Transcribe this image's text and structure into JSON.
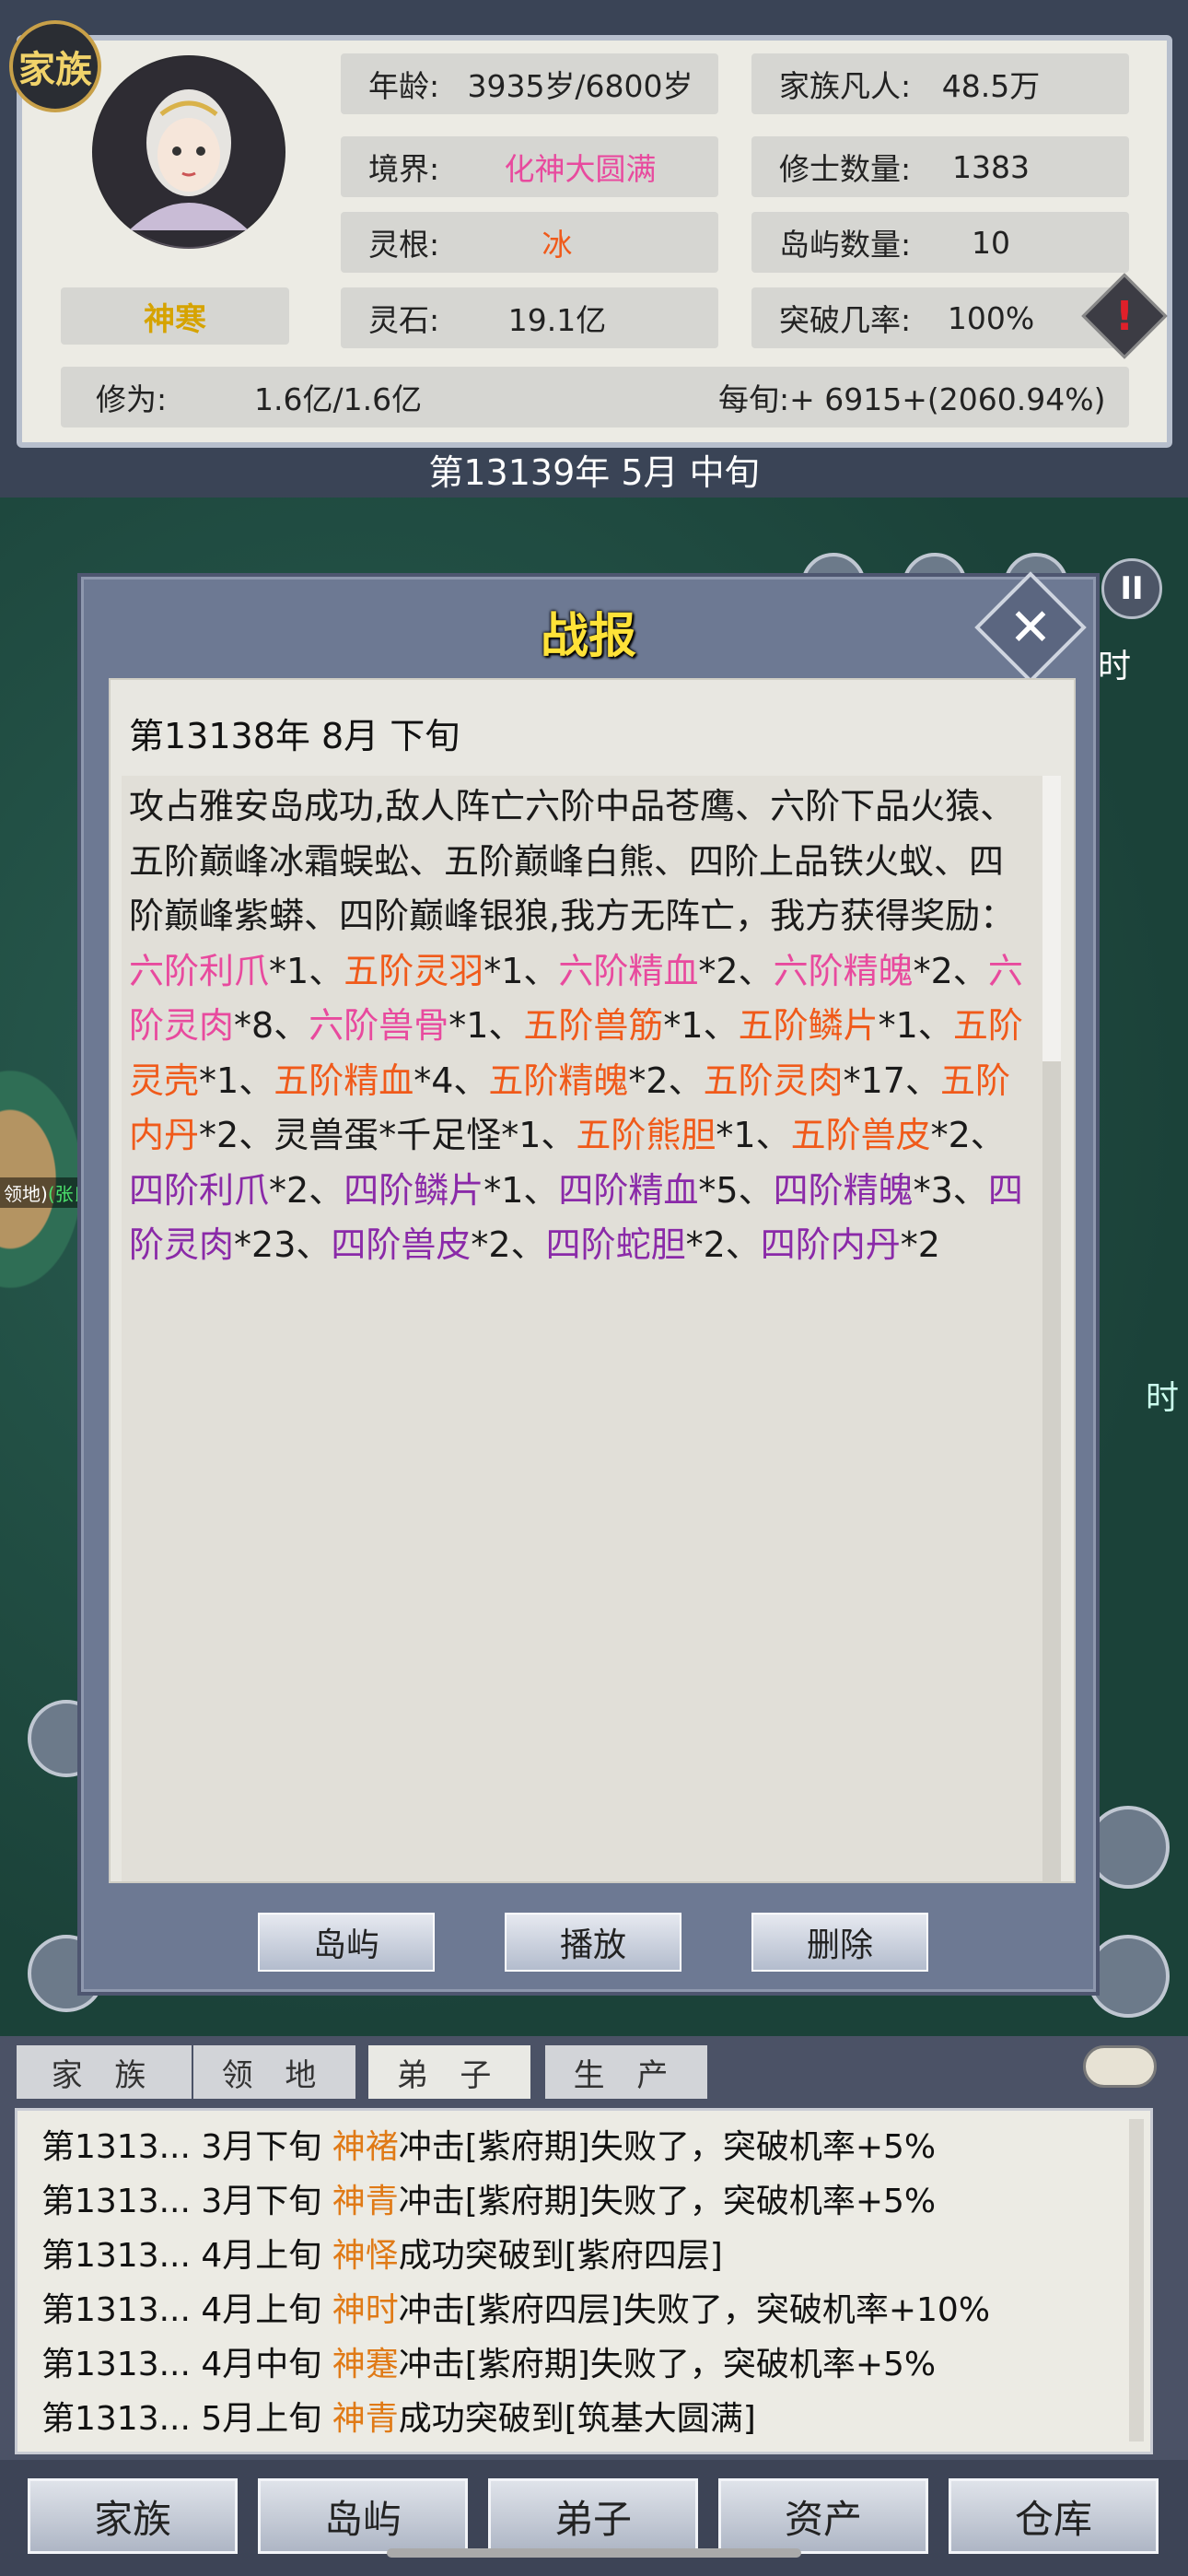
{
  "header": {
    "clan_badge": "家族",
    "character_name": "神寒",
    "age_label": "年龄:",
    "age_value": "3935岁/6800岁",
    "realm_label": "境界:",
    "realm_value": "化神大圆满",
    "spirit_root_label": "灵根:",
    "spirit_root_value": "冰",
    "spirit_stone_label": "灵石:",
    "spirit_stone_value": "19.1亿",
    "mortals_label": "家族凡人:",
    "mortals_value": "48.5万",
    "cultivators_label": "修士数量:",
    "cultivators_value": "1383",
    "islands_label": "岛屿数量:",
    "islands_value": "10",
    "breakthrough_label": "突破几率:",
    "breakthrough_value": "100%",
    "alert_icon": "exclamation-icon",
    "cultivation_label": "修为:",
    "cultivation_value": "1.6亿/1.6亿",
    "per_period": "每旬:+ 6915+(2060.94%)",
    "date": "第13139年 5月 中旬"
  },
  "map": {
    "island_label_prefix": "领地)",
    "island_label_owner": "(张氏",
    "pause_label": "II",
    "time_fragment": "时"
  },
  "dialog": {
    "title": "战报",
    "close_label": "✕",
    "report_date": "第13138年 8月 下旬",
    "report_segments": [
      {
        "t": "攻占雅安岛成功,敌人阵亡六阶中品苍鹰、六阶下品火猿、五阶巅峰冰霜蜈蚣、五阶巅峰白熊、四阶上品铁火蚁、四阶巅峰紫蟒、四阶巅峰银狼,我方无阵亡，我方获得奖励：",
        "c": ""
      },
      {
        "t": "六阶利爪",
        "c": "pink"
      },
      {
        "t": "*1、",
        "c": ""
      },
      {
        "t": "五阶灵羽",
        "c": "orange"
      },
      {
        "t": "*1、",
        "c": ""
      },
      {
        "t": "六阶精血",
        "c": "pink"
      },
      {
        "t": "*2、",
        "c": ""
      },
      {
        "t": "六阶精魄",
        "c": "pink"
      },
      {
        "t": "*2、",
        "c": ""
      },
      {
        "t": "六阶灵肉",
        "c": "pink"
      },
      {
        "t": "*8、",
        "c": ""
      },
      {
        "t": "六阶兽骨",
        "c": "pink"
      },
      {
        "t": "*1、",
        "c": ""
      },
      {
        "t": "五阶兽筋",
        "c": "orange"
      },
      {
        "t": "*1、",
        "c": ""
      },
      {
        "t": "五阶鳞片",
        "c": "orange"
      },
      {
        "t": "*1、",
        "c": ""
      },
      {
        "t": "五阶灵壳",
        "c": "orange"
      },
      {
        "t": "*1、",
        "c": ""
      },
      {
        "t": "五阶精血",
        "c": "orange"
      },
      {
        "t": "*4、",
        "c": ""
      },
      {
        "t": "五阶精魄",
        "c": "orange"
      },
      {
        "t": "*2、",
        "c": ""
      },
      {
        "t": "五阶灵肉",
        "c": "orange"
      },
      {
        "t": "*17、",
        "c": ""
      },
      {
        "t": "五阶内丹",
        "c": "orange"
      },
      {
        "t": "*2、灵兽蛋*千足怪*1、",
        "c": ""
      },
      {
        "t": "五阶熊胆",
        "c": "orange"
      },
      {
        "t": "*1、",
        "c": ""
      },
      {
        "t": "五阶兽皮",
        "c": "orange"
      },
      {
        "t": "*2、",
        "c": ""
      },
      {
        "t": "四阶利爪",
        "c": "purple"
      },
      {
        "t": "*2、",
        "c": ""
      },
      {
        "t": "四阶鳞片",
        "c": "purple"
      },
      {
        "t": "*1、",
        "c": ""
      },
      {
        "t": "四阶精血",
        "c": "purple"
      },
      {
        "t": "*5、",
        "c": ""
      },
      {
        "t": "四阶精魄",
        "c": "purple"
      },
      {
        "t": "*3、",
        "c": ""
      },
      {
        "t": "四阶灵肉",
        "c": "purple"
      },
      {
        "t": "*23、",
        "c": ""
      },
      {
        "t": "四阶兽皮",
        "c": "purple"
      },
      {
        "t": "*2、",
        "c": ""
      },
      {
        "t": "四阶蛇胆",
        "c": "purple"
      },
      {
        "t": "*2、",
        "c": ""
      },
      {
        "t": "四阶内丹",
        "c": "purple"
      },
      {
        "t": "*2",
        "c": ""
      }
    ],
    "buttons": {
      "island": "岛屿",
      "play": "播放",
      "delete": "删除"
    }
  },
  "log": {
    "tabs": [
      "家 族",
      "领 地",
      "弟 子",
      "生 产"
    ],
    "rows": [
      {
        "date": "第1313... 3月下旬 ",
        "name": "神褚",
        "text": "冲击[紫府期]失败了，突破机率+5%"
      },
      {
        "date": "第1313... 3月下旬 ",
        "name": "神青",
        "text": "冲击[紫府期]失败了，突破机率+5%"
      },
      {
        "date": "第1313... 4月上旬 ",
        "name": "神怿",
        "text": "成功突破到[紫府四层]"
      },
      {
        "date": "第1313... 4月上旬 ",
        "name": "神时",
        "text": "冲击[紫府四层]失败了，突破机率+10%"
      },
      {
        "date": "第1313... 4月中旬 ",
        "name": "神蹇",
        "text": "冲击[紫府期]失败了，突破机率+5%"
      },
      {
        "date": "第1313... 5月上旬 ",
        "name": "神青",
        "text": "成功突破到[筑基大圆满]"
      }
    ],
    "settings_icon": "settings-icon"
  },
  "nav": [
    "家族",
    "岛屿",
    "弟子",
    "资产",
    "仓库"
  ],
  "colors": {
    "pink": "#e84a9e",
    "orange": "#f05a1a",
    "purple": "#8a2aa8",
    "title": "#ffe238"
  }
}
